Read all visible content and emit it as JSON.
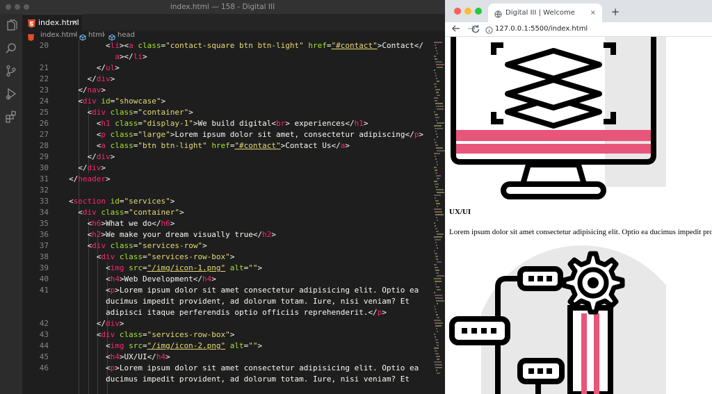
{
  "window": {
    "title": "index.html — 158 - Digital III"
  },
  "activity_bar": {
    "icons": [
      "explorer-icon",
      "search-icon",
      "source-control-icon",
      "run-debug-icon",
      "extensions-icon"
    ]
  },
  "editor": {
    "tab": {
      "label": "index.html",
      "close": "×"
    },
    "breadcrumbs": [
      "index.html",
      "html",
      "head"
    ],
    "lines": [
      {
        "n": "20",
        "tokens": [
          [
            "p",
            "<"
          ],
          [
            "t",
            "li"
          ],
          [
            "p",
            "><"
          ],
          [
            "t",
            "a"
          ],
          [
            "p",
            " "
          ],
          [
            "a",
            "class"
          ],
          [
            "p",
            "="
          ],
          [
            "s",
            "\"contact-square btn btn-light\""
          ],
          [
            "p",
            " "
          ],
          [
            "a",
            "href"
          ],
          [
            "p",
            "="
          ],
          [
            "u",
            "\"#contact\""
          ],
          [
            "p",
            ">Contact</"
          ]
        ]
      },
      {
        "n": "",
        "tokens": [
          [
            "t",
            "a"
          ],
          [
            "p",
            "></"
          ],
          [
            "t",
            "li"
          ],
          [
            "p",
            ">"
          ]
        ]
      },
      {
        "n": "21",
        "tokens": [
          [
            "p",
            "</"
          ],
          [
            "t",
            "ul"
          ],
          [
            "p",
            ">"
          ]
        ]
      },
      {
        "n": "22",
        "tokens": [
          [
            "p",
            "</"
          ],
          [
            "t",
            "div"
          ],
          [
            "p",
            ">"
          ]
        ]
      },
      {
        "n": "23",
        "tokens": [
          [
            "p",
            "</"
          ],
          [
            "t",
            "nav"
          ],
          [
            "p",
            ">"
          ]
        ]
      },
      {
        "n": "24",
        "tokens": [
          [
            "p",
            "<"
          ],
          [
            "t",
            "div"
          ],
          [
            "p",
            " "
          ],
          [
            "a",
            "id"
          ],
          [
            "p",
            "="
          ],
          [
            "s",
            "\"showcase\""
          ],
          [
            "p",
            ">"
          ]
        ]
      },
      {
        "n": "25",
        "tokens": [
          [
            "p",
            "<"
          ],
          [
            "t",
            "div"
          ],
          [
            "p",
            " "
          ],
          [
            "a",
            "class"
          ],
          [
            "p",
            "="
          ],
          [
            "s",
            "\"container\""
          ],
          [
            "p",
            ">"
          ]
        ]
      },
      {
        "n": "26",
        "tokens": [
          [
            "p",
            "<"
          ],
          [
            "t",
            "h1"
          ],
          [
            "p",
            " "
          ],
          [
            "a",
            "class"
          ],
          [
            "p",
            "="
          ],
          [
            "s",
            "\"display-1\""
          ],
          [
            "p",
            ">We build digital<"
          ],
          [
            "t",
            "br"
          ],
          [
            "p",
            "> experiences</"
          ],
          [
            "t",
            "h1"
          ],
          [
            "p",
            ">"
          ]
        ]
      },
      {
        "n": "27",
        "tokens": [
          [
            "p",
            "<"
          ],
          [
            "t",
            "p"
          ],
          [
            "p",
            " "
          ],
          [
            "a",
            "class"
          ],
          [
            "p",
            "="
          ],
          [
            "s",
            "\"large\""
          ],
          [
            "p",
            ">Lorem ipsum dolor sit amet, consectetur adipiscing</"
          ],
          [
            "t",
            "p"
          ],
          [
            "p",
            ">"
          ]
        ]
      },
      {
        "n": "28",
        "tokens": [
          [
            "p",
            "<"
          ],
          [
            "t",
            "a"
          ],
          [
            "p",
            " "
          ],
          [
            "a",
            "class"
          ],
          [
            "p",
            "="
          ],
          [
            "s",
            "\"btn btn-light\""
          ],
          [
            "p",
            " "
          ],
          [
            "a",
            "href"
          ],
          [
            "p",
            "="
          ],
          [
            "u",
            "\"#contact\""
          ],
          [
            "p",
            ">Contact Us</"
          ],
          [
            "t",
            "a"
          ],
          [
            "p",
            ">"
          ]
        ]
      },
      {
        "n": "29",
        "tokens": [
          [
            "p",
            "</"
          ],
          [
            "t",
            "div"
          ],
          [
            "p",
            ">"
          ]
        ]
      },
      {
        "n": "30",
        "tokens": [
          [
            "p",
            "</"
          ],
          [
            "t",
            "div"
          ],
          [
            "p",
            ">"
          ]
        ]
      },
      {
        "n": "31",
        "tokens": [
          [
            "p",
            "</"
          ],
          [
            "t",
            "header"
          ],
          [
            "p",
            ">"
          ]
        ]
      },
      {
        "n": "32",
        "tokens": []
      },
      {
        "n": "33",
        "tokens": [
          [
            "p",
            "<"
          ],
          [
            "t",
            "section"
          ],
          [
            "p",
            " "
          ],
          [
            "a",
            "id"
          ],
          [
            "p",
            "="
          ],
          [
            "s",
            "\"services\""
          ],
          [
            "p",
            ">"
          ]
        ]
      },
      {
        "n": "34",
        "tokens": [
          [
            "p",
            "<"
          ],
          [
            "t",
            "div"
          ],
          [
            "p",
            " "
          ],
          [
            "a",
            "class"
          ],
          [
            "p",
            "="
          ],
          [
            "s",
            "\"container\""
          ],
          [
            "p",
            ">"
          ]
        ]
      },
      {
        "n": "35",
        "tokens": [
          [
            "p",
            "<"
          ],
          [
            "t",
            "h6"
          ],
          [
            "p",
            ">What we do</"
          ],
          [
            "t",
            "h6"
          ],
          [
            "p",
            ">"
          ]
        ]
      },
      {
        "n": "36",
        "tokens": [
          [
            "p",
            "<"
          ],
          [
            "t",
            "h2"
          ],
          [
            "p",
            ">We make your dream visually true</"
          ],
          [
            "t",
            "h2"
          ],
          [
            "p",
            ">"
          ]
        ]
      },
      {
        "n": "37",
        "tokens": [
          [
            "p",
            "<"
          ],
          [
            "t",
            "div"
          ],
          [
            "p",
            " "
          ],
          [
            "a",
            "class"
          ],
          [
            "p",
            "="
          ],
          [
            "s",
            "\"services-row\""
          ],
          [
            "p",
            ">"
          ]
        ]
      },
      {
        "n": "38",
        "tokens": [
          [
            "p",
            "<"
          ],
          [
            "t",
            "div"
          ],
          [
            "p",
            " "
          ],
          [
            "a",
            "class"
          ],
          [
            "p",
            "="
          ],
          [
            "s",
            "\"services-row-box\""
          ],
          [
            "p",
            ">"
          ]
        ]
      },
      {
        "n": "39",
        "tokens": [
          [
            "p",
            "<"
          ],
          [
            "t",
            "img"
          ],
          [
            "p",
            " "
          ],
          [
            "a",
            "src"
          ],
          [
            "p",
            "="
          ],
          [
            "u",
            "\"/img/icon-1.png\""
          ],
          [
            "p",
            " "
          ],
          [
            "a",
            "alt"
          ],
          [
            "p",
            "="
          ],
          [
            "s",
            "\"\""
          ],
          [
            "p",
            ">"
          ]
        ]
      },
      {
        "n": "40",
        "tokens": [
          [
            "p",
            "<"
          ],
          [
            "t",
            "h4"
          ],
          [
            "p",
            ">Web Development</"
          ],
          [
            "t",
            "h4"
          ],
          [
            "p",
            ">"
          ]
        ]
      },
      {
        "n": "41",
        "tokens": [
          [
            "p",
            "<"
          ],
          [
            "t",
            "p"
          ],
          [
            "p",
            ">Lorem ipsum dolor sit amet consectetur adipisicing elit. Optio ea"
          ]
        ]
      },
      {
        "n": "",
        "tokens": [
          [
            "p",
            "ducimus impedit provident, ad dolorum totam. Iure, nisi veniam? Et"
          ]
        ]
      },
      {
        "n": "",
        "tokens": [
          [
            "p",
            "adipisci itaque perferendis optio officiis reprehenderit.</"
          ],
          [
            "t",
            "p"
          ],
          [
            "p",
            ">"
          ]
        ]
      },
      {
        "n": "42",
        "tokens": [
          [
            "p",
            "</"
          ],
          [
            "t",
            "div"
          ],
          [
            "p",
            ">"
          ]
        ]
      },
      {
        "n": "43",
        "tokens": [
          [
            "p",
            "<"
          ],
          [
            "t",
            "div"
          ],
          [
            "p",
            " "
          ],
          [
            "a",
            "class"
          ],
          [
            "p",
            "="
          ],
          [
            "s",
            "\"services-row-box\""
          ],
          [
            "p",
            ">"
          ]
        ]
      },
      {
        "n": "44",
        "tokens": [
          [
            "p",
            "<"
          ],
          [
            "t",
            "img"
          ],
          [
            "p",
            " "
          ],
          [
            "a",
            "src"
          ],
          [
            "p",
            "="
          ],
          [
            "u",
            "\"/img/icon-2.png\""
          ],
          [
            "p",
            " "
          ],
          [
            "a",
            "alt"
          ],
          [
            "p",
            "="
          ],
          [
            "s",
            "\"\""
          ],
          [
            "p",
            ">"
          ]
        ]
      },
      {
        "n": "45",
        "tokens": [
          [
            "p",
            "<"
          ],
          [
            "t",
            "h4"
          ],
          [
            "p",
            ">UX/UI</"
          ],
          [
            "t",
            "h4"
          ],
          [
            "p",
            ">"
          ]
        ]
      },
      {
        "n": "46",
        "tokens": [
          [
            "p",
            "<"
          ],
          [
            "t",
            "p"
          ],
          [
            "p",
            ">Lorem ipsum dolor sit amet consectetur adipisicing elit. Optio ea"
          ]
        ]
      },
      {
        "n": "",
        "tokens": [
          [
            "p",
            "ducimus impedit provident, ad dolorum totam. Iure, nisi veniam? Et"
          ]
        ]
      }
    ]
  },
  "browser": {
    "tab_title": "Digital III | Welcome",
    "tab_close": "×",
    "new_tab": "+",
    "url": "127.0.0.1:5500/index.html",
    "page": {
      "heading": "UX/UI",
      "paragraph": "Lorem ipsum dolor sit amet consectetur adipisicing elit. Optio ea ducimus impedit provident, ad dolorum totam."
    }
  },
  "colors": {
    "tag": "#f92672",
    "attribute": "#a6e22e",
    "string": "#e6db74",
    "accent_pink": "#e8557b",
    "icon_gray": "#e8e8e8"
  }
}
